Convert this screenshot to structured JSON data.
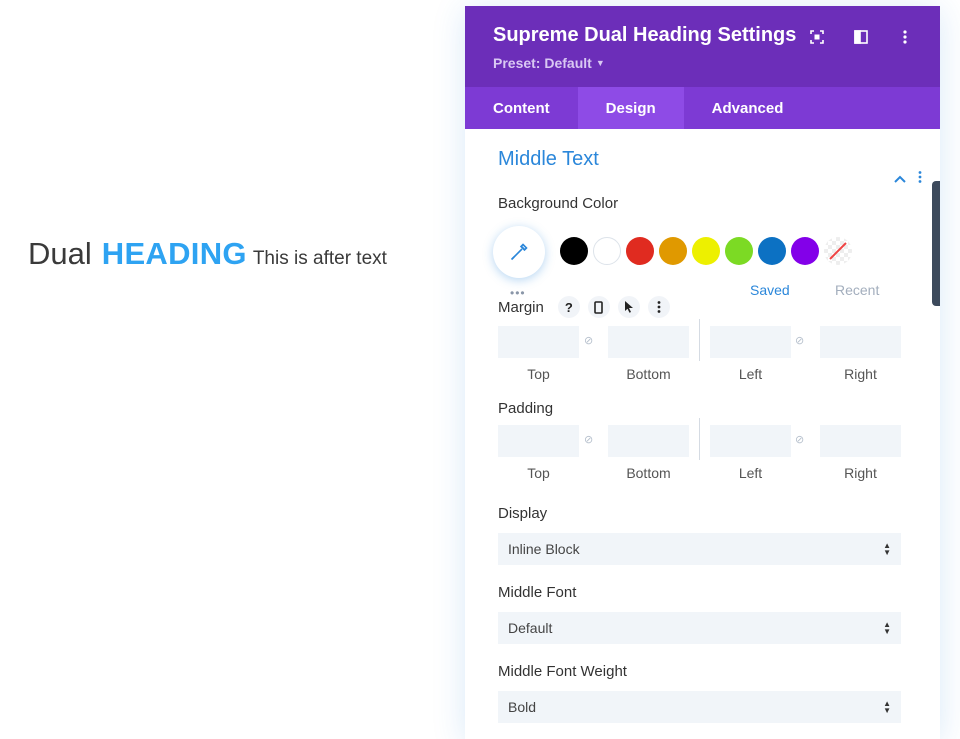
{
  "preview": {
    "before_text": "Dual",
    "main_text": "HEADING",
    "after_text": "This is after text",
    "main_color": "#2ea3f2"
  },
  "modal": {
    "title": "Supreme Dual Heading Settings",
    "preset": "Preset: Default",
    "header_icons": [
      "fullscreen-icon",
      "split-layout-icon",
      "more-vertical-icon"
    ],
    "header_color": "#6c2eb9",
    "tabs": [
      {
        "label": "Content",
        "active": false
      },
      {
        "label": "Design",
        "active": true
      },
      {
        "label": "Advanced",
        "active": false
      }
    ],
    "section_title": "Middle Text",
    "background_color": {
      "label": "Background Color",
      "swatches": [
        "#000000",
        "#ffffff",
        "#e02b20",
        "#e09900",
        "#edf000",
        "#7cda24",
        "#0c71c3",
        "#8300e9"
      ],
      "saved_label": "Saved",
      "recent_label": "Recent"
    },
    "margin": {
      "label": "Margin",
      "fields": [
        "",
        "",
        "",
        ""
      ],
      "captions": [
        "Top",
        "Bottom",
        "Left",
        "Right"
      ]
    },
    "padding": {
      "label": "Padding",
      "fields": [
        "",
        "",
        "",
        ""
      ],
      "captions": [
        "Top",
        "Bottom",
        "Left",
        "Right"
      ]
    },
    "display": {
      "label": "Display",
      "value": "Inline Block"
    },
    "middle_font": {
      "label": "Middle Font",
      "value": "Default"
    },
    "middle_font_weight": {
      "label": "Middle Font Weight",
      "value": "Bold"
    }
  }
}
